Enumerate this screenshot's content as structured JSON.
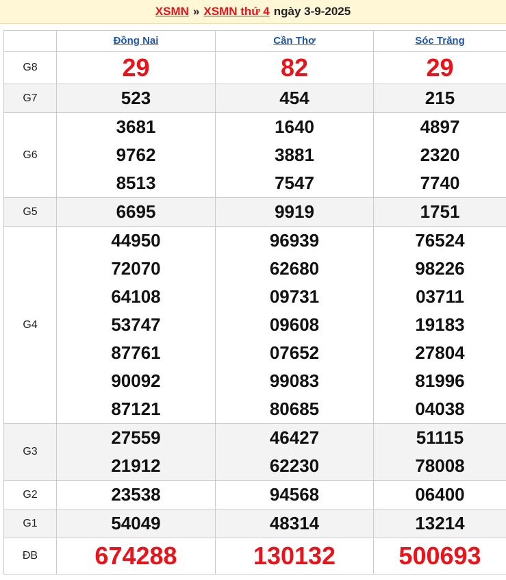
{
  "header": {
    "link1": "XSMN",
    "separator": "»",
    "link2": "XSMN thứ 4",
    "date": "ngày 3-9-2025"
  },
  "columns": [
    "Đồng Nai",
    "Cần Thơ",
    "Sóc Trăng"
  ],
  "colors": {
    "red": "#e8141c",
    "blue": "#1f56a8",
    "header_bg": "#fff7d6"
  },
  "prizes": [
    {
      "label": "G8",
      "values": [
        [
          "29"
        ],
        [
          "82"
        ],
        [
          "29"
        ]
      ]
    },
    {
      "label": "G7",
      "values": [
        [
          "523"
        ],
        [
          "454"
        ],
        [
          "215"
        ]
      ]
    },
    {
      "label": "G6",
      "values": [
        [
          "3681",
          "9762",
          "8513"
        ],
        [
          "1640",
          "3881",
          "7547"
        ],
        [
          "4897",
          "2320",
          "7740"
        ]
      ]
    },
    {
      "label": "G5",
      "values": [
        [
          "6695"
        ],
        [
          "9919"
        ],
        [
          "1751"
        ]
      ]
    },
    {
      "label": "G4",
      "values": [
        [
          "44950",
          "72070",
          "64108",
          "53747",
          "87761",
          "90092",
          "87121"
        ],
        [
          "96939",
          "62680",
          "09731",
          "09608",
          "07652",
          "99083",
          "80685"
        ],
        [
          "76524",
          "98226",
          "03711",
          "19183",
          "27804",
          "81996",
          "04038"
        ]
      ]
    },
    {
      "label": "G3",
      "values": [
        [
          "27559",
          "21912"
        ],
        [
          "46427",
          "62230"
        ],
        [
          "51115",
          "78008"
        ]
      ]
    },
    {
      "label": "G2",
      "values": [
        [
          "23538"
        ],
        [
          "94568"
        ],
        [
          "06400"
        ]
      ]
    },
    {
      "label": "G1",
      "values": [
        [
          "54049"
        ],
        [
          "48314"
        ],
        [
          "13214"
        ]
      ]
    },
    {
      "label": "ĐB",
      "values": [
        [
          "674288"
        ],
        [
          "130132"
        ],
        [
          "500693"
        ]
      ]
    }
  ]
}
